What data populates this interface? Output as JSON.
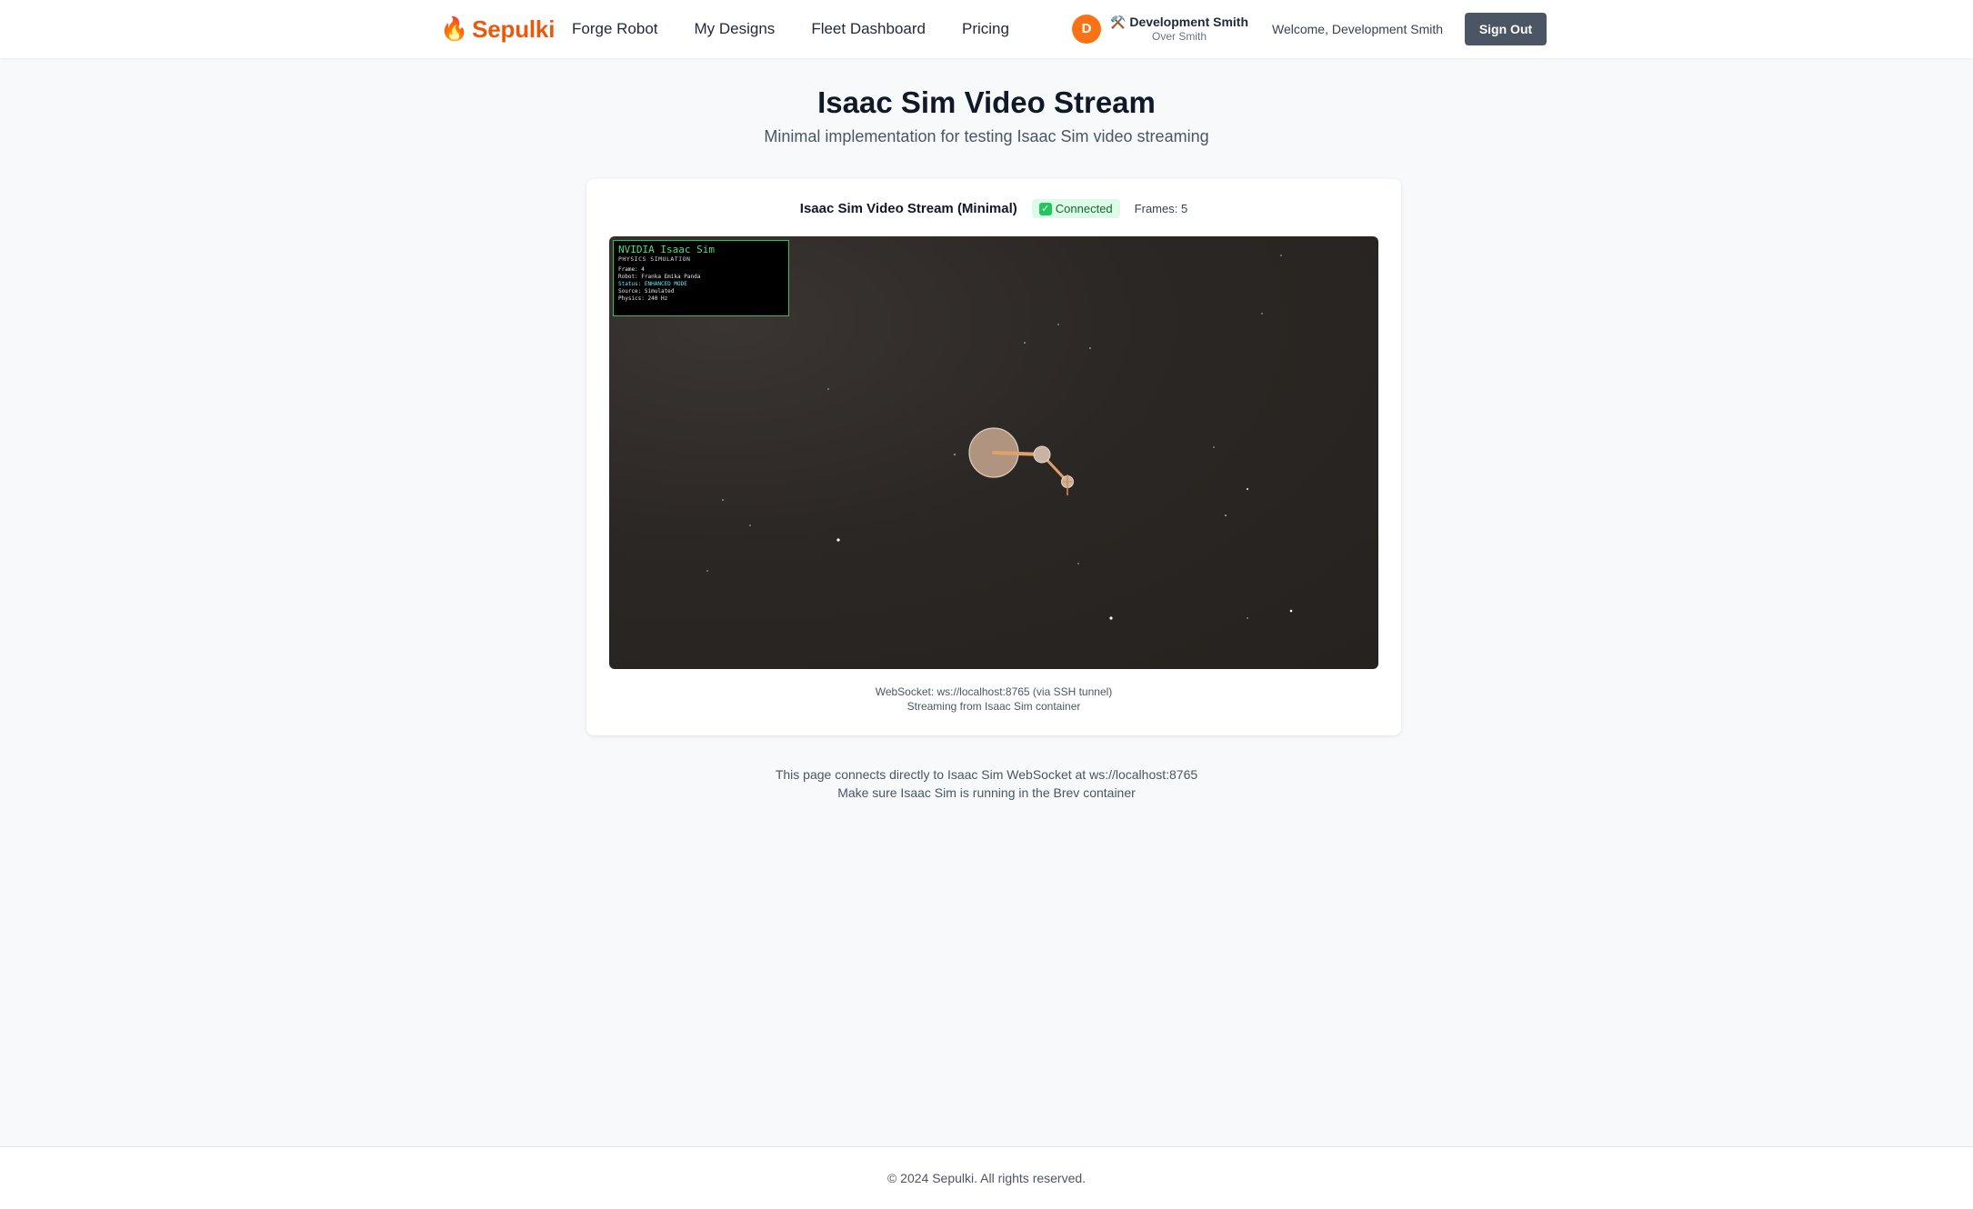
{
  "header": {
    "brand": {
      "icon": "flame-icon",
      "glyph": "🔥",
      "name": "Sepulki",
      "color": "#ea580c"
    },
    "nav": [
      {
        "label": "Forge Robot"
      },
      {
        "label": "My Designs"
      },
      {
        "label": "Fleet Dashboard"
      },
      {
        "label": "Pricing"
      }
    ],
    "user": {
      "avatar_initial": "D",
      "avatar_color": "#f97316",
      "role_icon": "hammer-pick-icon",
      "role_glyph": "⚒️",
      "name": "Development Smith",
      "role": "Over Smith"
    },
    "welcome": "Welcome, Development Smith",
    "sign_out_label": "Sign Out"
  },
  "main": {
    "title": "Isaac Sim Video Stream",
    "subtitle": "Minimal implementation for testing Isaac Sim video streaming",
    "card": {
      "stream_title": "Isaac Sim Video Stream (Minimal)",
      "status": {
        "icon": "check-icon",
        "label": "Connected",
        "color": "#22c55e"
      },
      "frames": "Frames: 5",
      "overlay": {
        "title": "NVIDIA Isaac Sim",
        "subtitle": "PHYSICS SIMULATION",
        "lines": [
          "Frame: 4",
          "Robot: Franka Emika Panda",
          "Status: ENHANCED MODE",
          "Source: Simulated",
          "Physics: 240 Hz"
        ]
      },
      "websocket": "WebSocket: ws://localhost:8765 (via SSH tunnel)",
      "streaming": "Streaming from Isaac Sim container"
    },
    "footnote_line1": "This page connects directly to Isaac Sim WebSocket at ws://localhost:8765",
    "footnote_line2": "Make sure Isaac Sim is running in the Brev container"
  },
  "footer": {
    "copyright": "© 2024 Sepulki. All rights reserved."
  }
}
